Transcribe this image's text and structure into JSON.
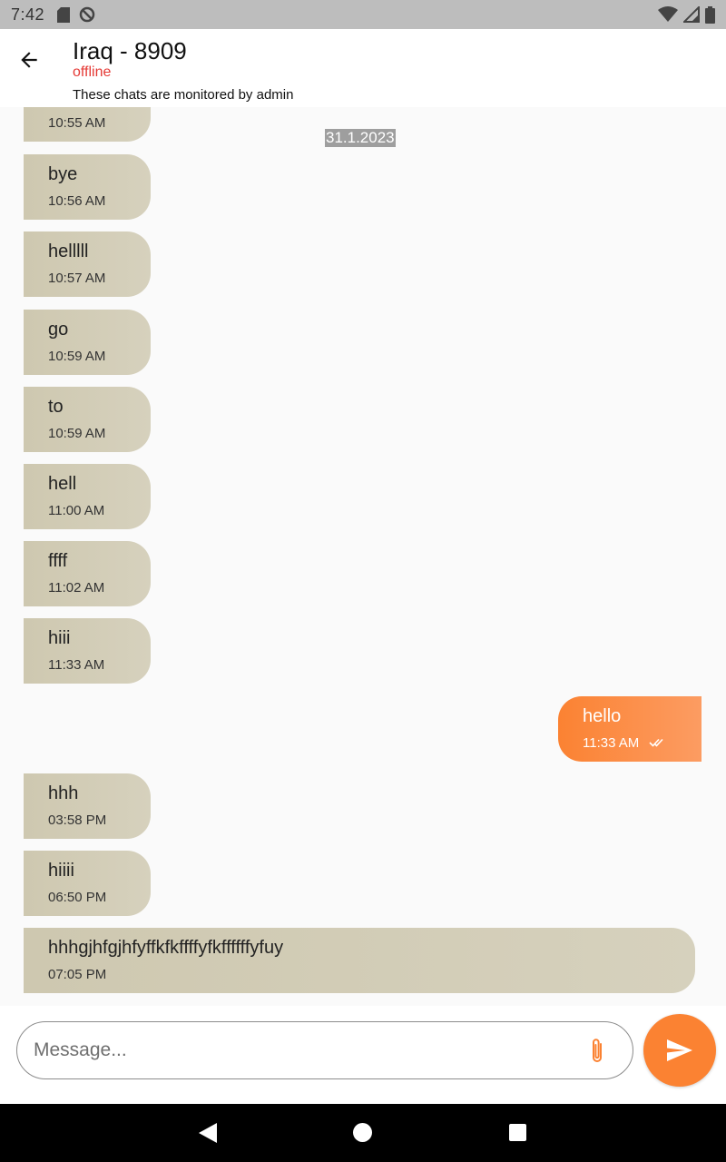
{
  "status_bar": {
    "time": "7:42",
    "left_icons": [
      "sd-card-icon",
      "no-sync-icon"
    ],
    "right_icons": [
      "wifi-icon",
      "signal-icon",
      "battery-icon"
    ]
  },
  "header": {
    "title": "Iraq - 8909",
    "status": "offline",
    "note": "These chats are monitored by admin"
  },
  "date_divider": "31.1.2023",
  "messages": [
    {
      "dir": "in",
      "text": "",
      "time": "10:55 AM"
    },
    {
      "dir": "in",
      "text": "bye",
      "time": "10:56 AM"
    },
    {
      "dir": "in",
      "text": "helllll",
      "time": "10:57 AM"
    },
    {
      "dir": "in",
      "text": "go",
      "time": "10:59 AM"
    },
    {
      "dir": "in",
      "text": "to",
      "time": "10:59 AM"
    },
    {
      "dir": "in",
      "text": "hell",
      "time": "11:00 AM"
    },
    {
      "dir": "in",
      "text": "ffff",
      "time": "11:02 AM"
    },
    {
      "dir": "in",
      "text": "hiii",
      "time": "11:33 AM"
    },
    {
      "dir": "out",
      "text": "hello",
      "time": "11:33 AM",
      "read": true
    },
    {
      "dir": "in",
      "text": "hhh",
      "time": "03:58 PM"
    },
    {
      "dir": "in",
      "text": "hiiii",
      "time": "06:50 PM"
    },
    {
      "dir": "in",
      "text": "hhhgjhfgjhfyffkfkffffyfkffffffyfuy",
      "time": "07:05 PM"
    }
  ],
  "composer": {
    "placeholder": "Message...",
    "value": ""
  },
  "colors": {
    "accent": "#fb8232",
    "incoming_bubble": "#cec8b0",
    "status_offline": "#e53935"
  }
}
